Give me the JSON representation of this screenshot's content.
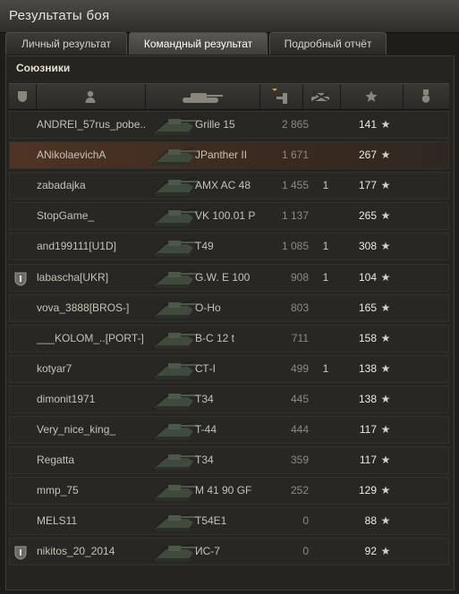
{
  "window": {
    "title": "Результаты боя"
  },
  "tabs": [
    {
      "label": "Личный результат",
      "active": false
    },
    {
      "label": "Командный результат",
      "active": true
    },
    {
      "label": "Подробный отчёт",
      "active": false
    }
  ],
  "section": {
    "title": "Союзники"
  },
  "columns": {
    "icons": [
      "squad-icon",
      "player-icon",
      "tank-icon",
      "xp-sort-icon",
      "kills-icon",
      "star-icon",
      "medal-icon"
    ]
  },
  "players": [
    {
      "name": "ANDREI_57rus_pobe..",
      "tank": "Grille 15",
      "xp": "2 865",
      "kills": "",
      "exp": "141",
      "squad": false,
      "highlight": false
    },
    {
      "name": "ANikolaevichA",
      "tank": "JPanther II",
      "xp": "1 671",
      "kills": "",
      "exp": "267",
      "squad": false,
      "highlight": true
    },
    {
      "name": "zabadajka",
      "tank": "AMX AC 48",
      "xp": "1 455",
      "kills": "1",
      "exp": "177",
      "squad": false,
      "highlight": false
    },
    {
      "name": "StopGame_",
      "tank": "VK 100.01 P",
      "xp": "1 137",
      "kills": "",
      "exp": "265",
      "squad": false,
      "highlight": false
    },
    {
      "name": "and199111[U1D]",
      "tank": "T49",
      "xp": "1 085",
      "kills": "1",
      "exp": "308",
      "squad": false,
      "highlight": false
    },
    {
      "name": "labascha[UKR]",
      "tank": "G.W. E 100",
      "xp": "908",
      "kills": "1",
      "exp": "104",
      "squad": true,
      "highlight": false
    },
    {
      "name": "vova_3888[BROS-]",
      "tank": "O-Ho",
      "xp": "803",
      "kills": "",
      "exp": "165",
      "squad": false,
      "highlight": false
    },
    {
      "name": "___KOLOM_..[PORT-]",
      "tank": "B-C 12 t",
      "xp": "711",
      "kills": "",
      "exp": "158",
      "squad": false,
      "highlight": false
    },
    {
      "name": "kotyar7",
      "tank": "СТ-I",
      "xp": "499",
      "kills": "1",
      "exp": "138",
      "squad": false,
      "highlight": false
    },
    {
      "name": "dimonit1971",
      "tank": "T34",
      "xp": "445",
      "kills": "",
      "exp": "138",
      "squad": false,
      "highlight": false
    },
    {
      "name": "Very_nice_king_",
      "tank": "T-44",
      "xp": "444",
      "kills": "",
      "exp": "117",
      "squad": false,
      "highlight": false
    },
    {
      "name": "Regatta",
      "tank": "T34",
      "xp": "359",
      "kills": "",
      "exp": "117",
      "squad": false,
      "highlight": false
    },
    {
      "name": "mmp_75",
      "tank": "M 41 90 GF",
      "xp": "252",
      "kills": "",
      "exp": "129",
      "squad": false,
      "highlight": false
    },
    {
      "name": "MELS11",
      "tank": "T54E1",
      "xp": "0",
      "kills": "",
      "exp": "88",
      "squad": false,
      "highlight": false
    },
    {
      "name": "nikitos_20_2014",
      "tank": "ИС-7",
      "xp": "0",
      "kills": "",
      "exp": "92",
      "squad": true,
      "highlight": false
    }
  ],
  "symbols": {
    "star": "★"
  },
  "colors": {
    "highlight_row": "#4e3424",
    "text": "#c7c2b6",
    "dim": "#8f8a80"
  }
}
